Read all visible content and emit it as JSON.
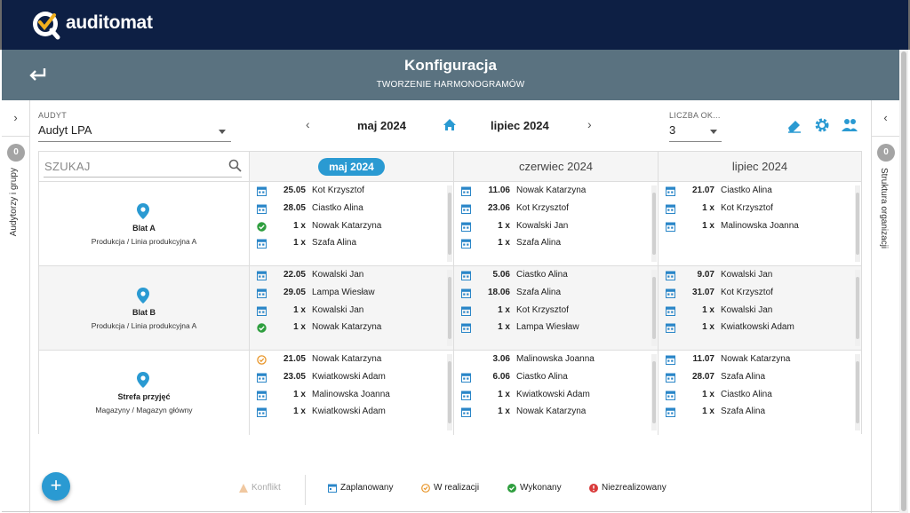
{
  "app": {
    "logo_text": "auditomat"
  },
  "header": {
    "title": "Konfiguracja",
    "subtitle": "TWORZENIE HARMONOGRAMÓW"
  },
  "left_panel": {
    "badge": "0",
    "label": "Audytorzy i grupy"
  },
  "right_panel": {
    "badge": "0",
    "label": "Struktura organizacji"
  },
  "audit": {
    "label": "AUDYT",
    "value": "Audyt LPA"
  },
  "nav": {
    "prev_month": "maj 2024",
    "next_month": "lipiec 2024"
  },
  "months_count": {
    "label": "LICZBA OK...",
    "value": "3"
  },
  "search": {
    "placeholder": "SZUKAJ"
  },
  "columns": [
    "maj 2024",
    "czerwiec 2024",
    "lipiec 2024"
  ],
  "rows": [
    {
      "name": "Blat A",
      "sub": "Produkcja / Linia produkcyjna A",
      "cells": [
        [
          {
            "s": "planned",
            "d": "25.05",
            "n": "Kot Krzysztof"
          },
          {
            "s": "planned",
            "d": "28.05",
            "n": "Ciastko Alina"
          },
          {
            "s": "done",
            "d": "1 x",
            "n": "Nowak Katarzyna"
          },
          {
            "s": "planned",
            "d": "1 x",
            "n": "Szafa Alina"
          }
        ],
        [
          {
            "s": "planned",
            "d": "11.06",
            "n": "Nowak Katarzyna"
          },
          {
            "s": "planned",
            "d": "23.06",
            "n": "Kot Krzysztof"
          },
          {
            "s": "planned",
            "d": "1 x",
            "n": "Kowalski Jan"
          },
          {
            "s": "planned",
            "d": "1 x",
            "n": "Szafa Alina"
          }
        ],
        [
          {
            "s": "planned",
            "d": "21.07",
            "n": "Ciastko Alina"
          },
          {
            "s": "planned",
            "d": "1 x",
            "n": "Kot Krzysztof"
          },
          {
            "s": "planned",
            "d": "1 x",
            "n": "Malinowska Joanna"
          }
        ]
      ]
    },
    {
      "name": "Blat B",
      "sub": "Produkcja / Linia produkcyjna A",
      "cells": [
        [
          {
            "s": "planned",
            "d": "22.05",
            "n": "Kowalski Jan"
          },
          {
            "s": "planned",
            "d": "29.05",
            "n": "Lampa Wiesław"
          },
          {
            "s": "planned",
            "d": "1 x",
            "n": "Kowalski Jan"
          },
          {
            "s": "done",
            "d": "1 x",
            "n": "Nowak Katarzyna"
          }
        ],
        [
          {
            "s": "planned",
            "d": "5.06",
            "n": "Ciastko Alina"
          },
          {
            "s": "planned",
            "d": "18.06",
            "n": "Szafa Alina"
          },
          {
            "s": "planned",
            "d": "1 x",
            "n": "Kot Krzysztof"
          },
          {
            "s": "planned",
            "d": "1 x",
            "n": "Lampa Wiesław"
          }
        ],
        [
          {
            "s": "planned",
            "d": "9.07",
            "n": "Kowalski Jan"
          },
          {
            "s": "planned",
            "d": "31.07",
            "n": "Kot Krzysztof"
          },
          {
            "s": "planned",
            "d": "1 x",
            "n": "Kowalski Jan"
          },
          {
            "s": "planned",
            "d": "1 x",
            "n": "Kwiatkowski Adam"
          }
        ]
      ]
    },
    {
      "name": "Strefa przyjęć",
      "sub": "Magazyny / Magazyn główny",
      "cells": [
        [
          {
            "s": "progress",
            "d": "21.05",
            "n": "Nowak Katarzyna"
          },
          {
            "s": "planned",
            "d": "23.05",
            "n": "Kwiatkowski Adam"
          },
          {
            "s": "planned",
            "d": "1 x",
            "n": "Malinowska Joanna"
          },
          {
            "s": "planned",
            "d": "1 x",
            "n": "Kwiatkowski Adam"
          }
        ],
        [
          {
            "s": "none",
            "d": "3.06",
            "n": "Malinowska Joanna"
          },
          {
            "s": "planned",
            "d": "6.06",
            "n": "Ciastko Alina"
          },
          {
            "s": "planned",
            "d": "1 x",
            "n": "Kwiatkowski Adam"
          },
          {
            "s": "planned",
            "d": "1 x",
            "n": "Nowak Katarzyna"
          }
        ],
        [
          {
            "s": "planned",
            "d": "11.07",
            "n": "Nowak Katarzyna"
          },
          {
            "s": "planned",
            "d": "28.07",
            "n": "Szafa Alina"
          },
          {
            "s": "planned",
            "d": "1 x",
            "n": "Ciastko Alina"
          },
          {
            "s": "planned",
            "d": "1 x",
            "n": "Szafa Alina"
          }
        ]
      ]
    }
  ],
  "legend": {
    "conflict": "Konflikt",
    "planned": "Zaplanowany",
    "in_progress": "W realizacji",
    "done": "Wykonany",
    "not_done": "Niezrealizowany"
  },
  "colors": {
    "navy": "#0d1f44",
    "header": "#5a7280",
    "accent": "#2a9ad2",
    "planned": "#2a86c8",
    "done": "#2e9e3e",
    "progress": "#e8962a",
    "not_done": "#d93b3b",
    "conflict": "#f0b878"
  }
}
